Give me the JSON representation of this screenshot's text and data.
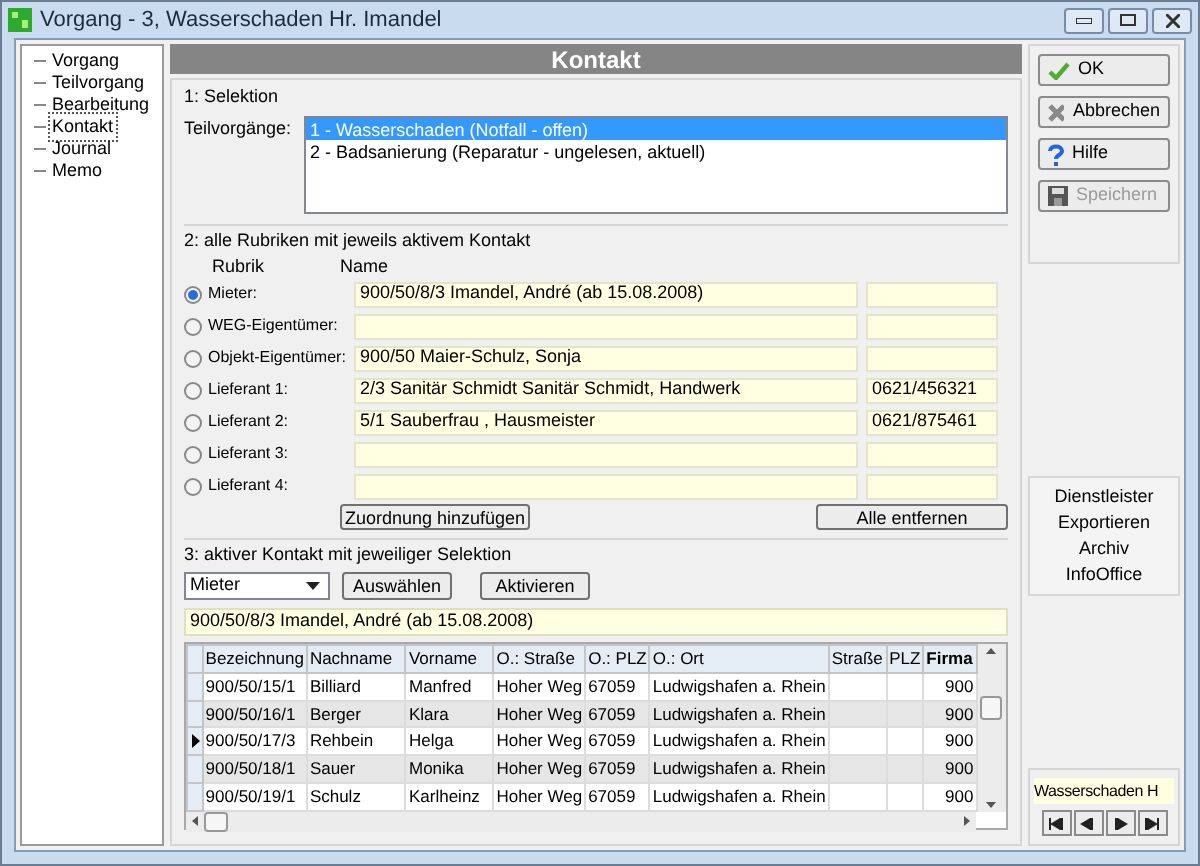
{
  "window": {
    "title": "Vorgang - 3, Wasserschaden Hr. Imandel"
  },
  "tree": {
    "items": [
      {
        "label": "Vorgang",
        "selected": false
      },
      {
        "label": "Teilvorgang",
        "selected": false
      },
      {
        "label": "Bearbeitung",
        "selected": false
      },
      {
        "label": "Kontakt",
        "selected": true
      },
      {
        "label": "Journal",
        "selected": false
      },
      {
        "label": "Memo",
        "selected": false
      }
    ]
  },
  "header": "Kontakt",
  "selektion": {
    "title": "1: Selektion",
    "label": "Teilvorgänge:",
    "items": [
      {
        "text": "1 - Wasserschaden (Notfall - offen)",
        "selected": true
      },
      {
        "text": "2 - Badsanierung (Reparatur - ungelesen, aktuell)",
        "selected": false
      }
    ]
  },
  "rubriken": {
    "title": "2: alle Rubriken mit jeweils aktivem Kontakt",
    "col_rubrik": "Rubrik",
    "col_name": "Name",
    "rows": [
      {
        "label": "Mieter:",
        "selected": true,
        "name": "900/50/8/3  Imandel, André  (ab 15.08.2008)",
        "phone": ""
      },
      {
        "label": "WEG-Eigentümer:",
        "selected": false,
        "name": "",
        "phone": ""
      },
      {
        "label": "Objekt-Eigentümer:",
        "selected": false,
        "name": "900/50  Maier-Schulz, Sonja",
        "phone": ""
      },
      {
        "label": "Lieferant 1:",
        "selected": false,
        "name": "2/3  Sanitär Schmidt  Sanitär Schmidt, Handwerk",
        "phone": "0621/456321"
      },
      {
        "label": "Lieferant 2:",
        "selected": false,
        "name": "5/1  Sauberfrau  , Hausmeister",
        "phone": "0621/875461"
      },
      {
        "label": "Lieferant 3:",
        "selected": false,
        "name": "",
        "phone": ""
      },
      {
        "label": "Lieferant 4:",
        "selected": false,
        "name": "",
        "phone": ""
      }
    ],
    "buttons": [
      "Zuordnung hinzufügen",
      "Alle entfernen"
    ]
  },
  "aktiv": {
    "title": "3: aktiver Kontakt mit jeweiliger Selektion",
    "dropdown": "Mieter",
    "buttons": [
      "Auswählen",
      "Aktivieren"
    ],
    "current": "900/50/8/3  Imandel, André  (ab 15.08.2008)",
    "table": {
      "columns": [
        "Bezeichnung",
        "Nachname",
        "Vorname",
        "O.: Straße",
        "O.: PLZ",
        "O.: Ort",
        "Straße",
        "PLZ",
        "Firma"
      ],
      "rows": [
        {
          "selected": false,
          "cells": [
            "900/50/15/1",
            "Billiard",
            "Manfred",
            "Hoher Weg",
            "67059",
            "Ludwigshafen a. Rhein",
            "",
            "",
            "900"
          ]
        },
        {
          "selected": false,
          "cells": [
            "900/50/16/1",
            "Berger",
            "Klara",
            "Hoher Weg",
            "67059",
            "Ludwigshafen a. Rhein",
            "",
            "",
            "900"
          ]
        },
        {
          "selected": true,
          "cells": [
            "900/50/17/3",
            "Rehbein",
            "Helga",
            "Hoher Weg",
            "67059",
            "Ludwigshafen a. Rhein",
            "",
            "",
            "900"
          ]
        },
        {
          "selected": false,
          "cells": [
            "900/50/18/1",
            "Sauer",
            "Monika",
            "Hoher Weg",
            "67059",
            "Ludwigshafen a. Rhein",
            "",
            "",
            "900"
          ]
        },
        {
          "selected": false,
          "cells": [
            "900/50/19/1",
            "Schulz",
            "Karlheinz",
            "Hoher Weg",
            "67059",
            "Ludwigshafen a. Rhein",
            "",
            "",
            "900"
          ]
        }
      ]
    }
  },
  "actions": [
    {
      "label": "OK",
      "disabled": false
    },
    {
      "label": "Abbrechen",
      "disabled": false
    },
    {
      "label": "Hilfe",
      "disabled": false
    },
    {
      "label": "Speichern",
      "disabled": true
    }
  ],
  "links": [
    "Dienstleister",
    "Exportieren",
    "Archiv",
    "InfoOffice"
  ],
  "navigator": {
    "value": "Wasserschaden H"
  }
}
